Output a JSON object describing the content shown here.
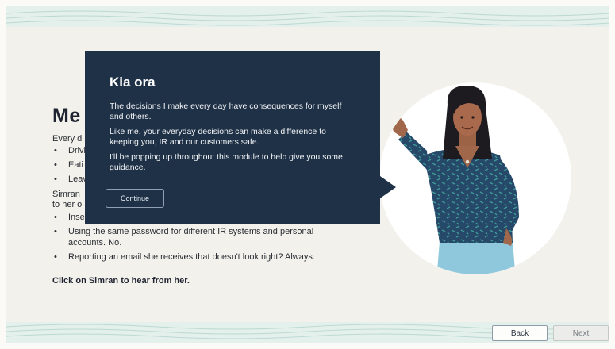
{
  "slide": {
    "heading": "Me",
    "intro": "Every d",
    "list1": [
      "Drivi",
      "Eati",
      "Leav"
    ],
    "para2_line1": "Simran",
    "para2_line2": "to her o",
    "list2": [
      "Inse",
      "Using the same password for different IR systems and personal accounts. No.",
      "Reporting an email she receives that doesn't look right? Always."
    ],
    "cta": "Click on Simran to hear from her."
  },
  "popup": {
    "title": "Kia ora",
    "p1": "The decisions I make every day have consequences for myself and others.",
    "p2": "Like me, your everyday decisions can make a difference to keeping you, IR and our customers safe.",
    "p3": "I'll be popping up throughout this module to help give you some guidance.",
    "continue_label": "Continue"
  },
  "nav": {
    "back_label": "Back",
    "next_label": "Next"
  },
  "colors": {
    "popup_bg": "#1f3146",
    "slide_bg": "#f2f1ec",
    "band": "#e4f0ec",
    "shirt": "#26496a",
    "skirt": "#8fc8dc"
  },
  "icons": {
    "character": "simran-illustration"
  }
}
